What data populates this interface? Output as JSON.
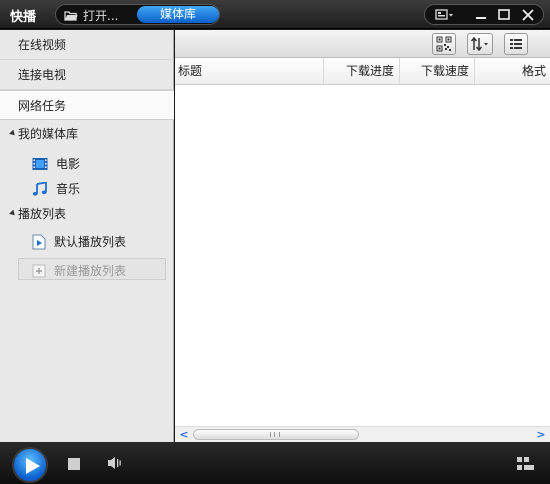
{
  "titlebar": {
    "app_name": "快播",
    "tab_open_label": "打开...",
    "tab_media_label": "媒体库"
  },
  "sidebar": {
    "nav": [
      {
        "label": "在线视频"
      },
      {
        "label": "连接电视"
      },
      {
        "label": "网络任务"
      }
    ],
    "media_library": {
      "title": "我的媒体库",
      "items": [
        {
          "label": "电影",
          "icon": "film-icon"
        },
        {
          "label": "音乐",
          "icon": "music-note-icon"
        }
      ]
    },
    "playlists": {
      "title": "播放列表",
      "items": [
        {
          "label": "默认播放列表",
          "icon": "playlist-icon"
        },
        {
          "label": "新建播放列表",
          "icon": "add-icon"
        }
      ]
    }
  },
  "table": {
    "columns": [
      "标题",
      "下载进度",
      "下载速度",
      "格式"
    ],
    "rows": []
  },
  "colors": {
    "accent": "#1a7fe0",
    "titlebar_bg": "#2a2a2a",
    "sidebar_bg": "#e8e8e8"
  }
}
